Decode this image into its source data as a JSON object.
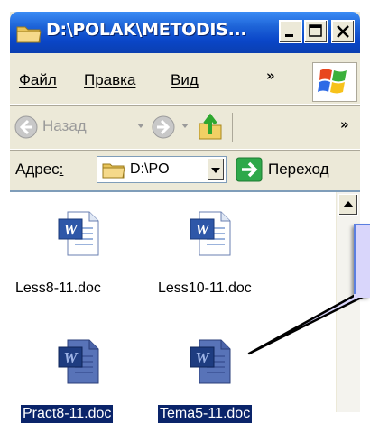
{
  "window": {
    "title": "D:\\POLAK\\METODIS...",
    "controls": {
      "minimize": "minimize",
      "maximize": "maximize",
      "close": "close"
    }
  },
  "menu": {
    "items": [
      {
        "label": "Файл"
      },
      {
        "label": "Правка"
      },
      {
        "label": "Вид"
      }
    ],
    "overflow": "»"
  },
  "toolbar": {
    "back_label": "Назад",
    "overflow": "»"
  },
  "address": {
    "label": "Адрес:",
    "value": "D:\\PO",
    "go_label": "Переход"
  },
  "files": [
    {
      "name": "Less8-11.doc",
      "selected": false
    },
    {
      "name": "Less10-11.doc",
      "selected": false
    },
    {
      "name": "Pract8-11.doc",
      "selected": true
    },
    {
      "name": "Tema5-11.doc",
      "selected": true
    }
  ],
  "colors": {
    "title_bar": "#0A46C8",
    "selection": "#0A246A",
    "callout_fill": "#D9D6FB",
    "callout_border": "#5B7FE0"
  },
  "icons": [
    "folder-icon",
    "windows-logo-icon",
    "back-arrow-icon",
    "forward-arrow-icon",
    "up-folder-icon",
    "go-arrow-icon",
    "word-document-icon"
  ]
}
